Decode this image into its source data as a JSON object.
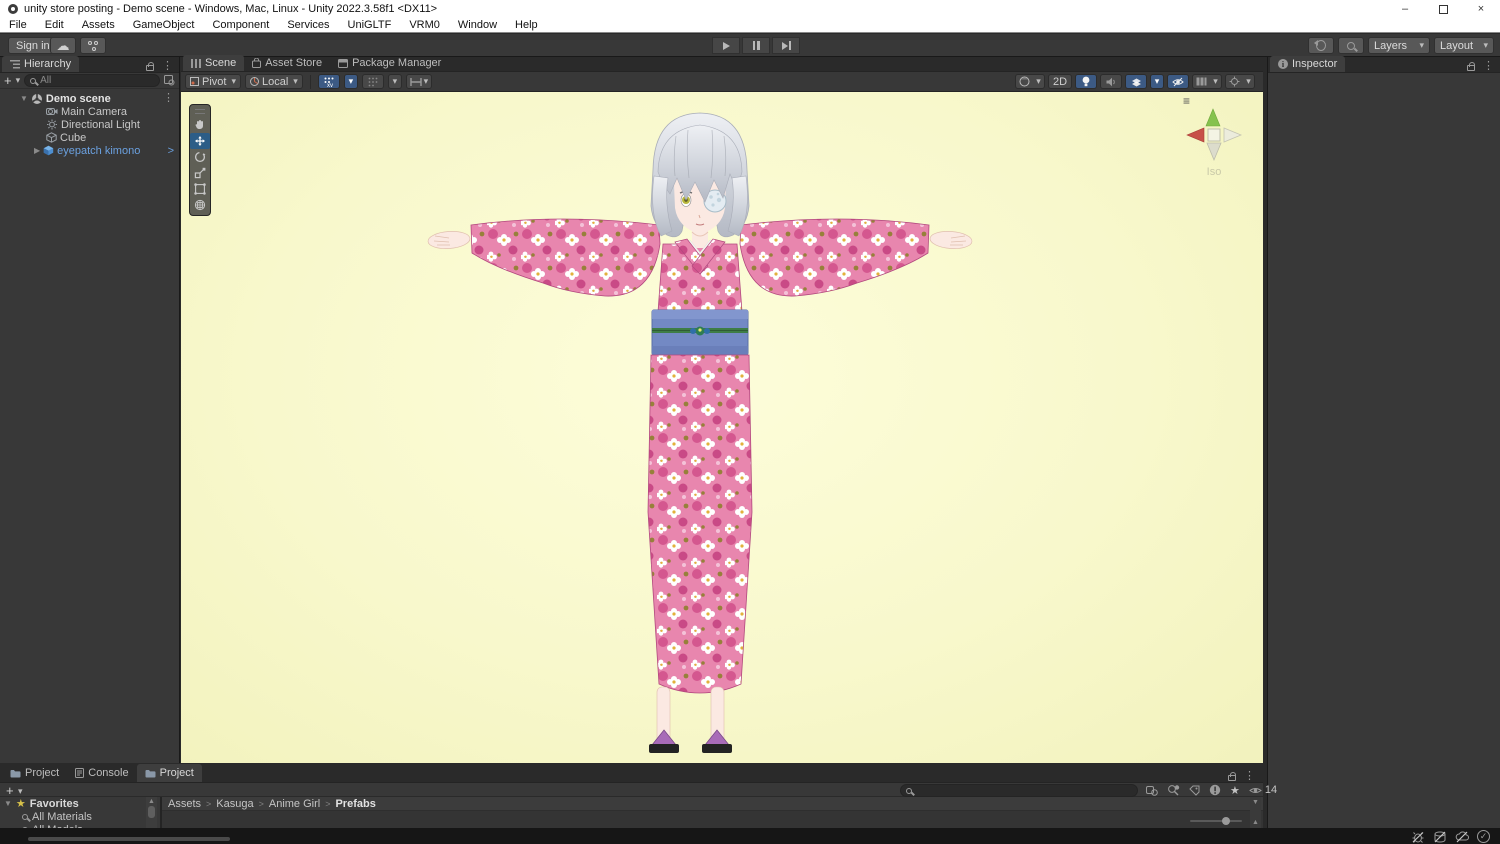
{
  "window": {
    "title": "unity store posting - Demo scene - Windows, Mac, Linux - Unity 2022.3.58f1 <DX11>"
  },
  "menu": {
    "items": [
      "File",
      "Edit",
      "Assets",
      "GameObject",
      "Component",
      "Services",
      "UniGLTF",
      "VRM0",
      "Window",
      "Help"
    ]
  },
  "toolbar": {
    "sign_in": "Sign in",
    "layers": "Layers",
    "layout": "Layout"
  },
  "hierarchy": {
    "tab": "Hierarchy",
    "search_placeholder": "All",
    "root": "Demo scene",
    "items": [
      {
        "label": "Main Camera"
      },
      {
        "label": "Directional Light"
      },
      {
        "label": "Cube"
      },
      {
        "label": "eyepatch kimono"
      }
    ]
  },
  "scene": {
    "tabs": [
      "Scene",
      "Asset Store",
      "Package Manager"
    ],
    "pivot": "Pivot",
    "local": "Local",
    "mode_2d": "2D",
    "gizmo_label": "Iso"
  },
  "inspector": {
    "tab": "Inspector"
  },
  "project": {
    "tab_project1": "Project",
    "tab_console": "Console",
    "tab_project2": "Project",
    "favorites": {
      "header": "Favorites",
      "items": [
        "All Materials",
        "All Models"
      ]
    },
    "breadcrumb": [
      "Assets",
      "Kasuga",
      "Anime Girl",
      "Prefabs"
    ],
    "visible_count": "14"
  },
  "icons": {
    "kebab": "⋮",
    "dropdown": "▾",
    "plus": "+",
    "expand_open": "▼",
    "expand_closed": "▶",
    "chevron": ">",
    "star": "★",
    "cloud": "☁",
    "check": "✓",
    "menu": "≡",
    "minimize": "–",
    "close": "×"
  },
  "colors": {
    "accent_blue": "#3c5a84",
    "prefab_text": "#6ba1e0",
    "scene_bg": "#f8f8cc",
    "kimono_pink": "#e886ae",
    "obi_blue": "#7389c4"
  }
}
